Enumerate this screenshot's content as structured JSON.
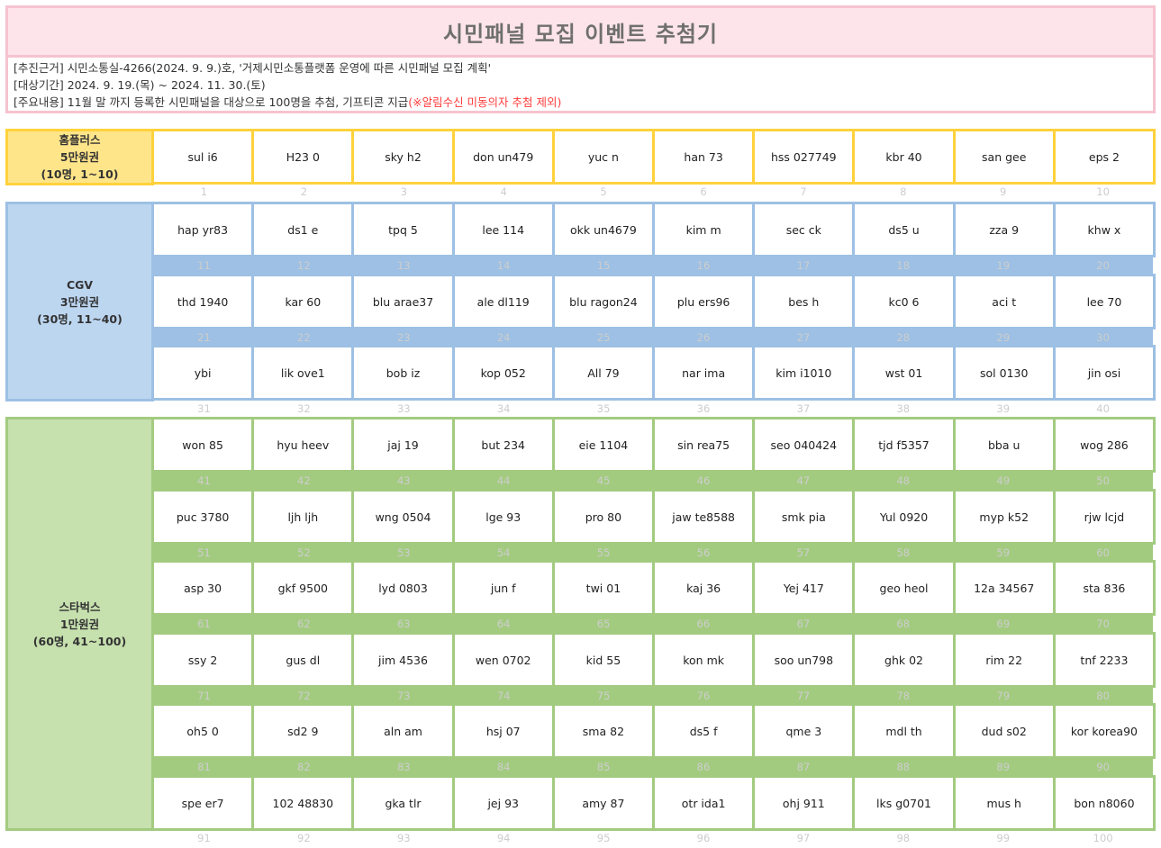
{
  "header": {
    "title": "시민패널 모집 이벤트 추첨기"
  },
  "info": {
    "line1": "[추진근거] 시민소통실-4266(2024. 9. 9.)호, '거제시민소통플랫폼 운영에 따른 시민패널 모집 계획'",
    "line2": "[대상기간] 2024. 9. 19.(목) ~ 2024. 11. 30.(토)",
    "line3_main": "[주요내용] 11월 말 까지 등록한 시민패널을 대상으로 100명을 추첨, 기프티콘 지급",
    "line3_note": "(※알림수신 미동의자 추첨 제외)"
  },
  "colors": {
    "pink_fill": "#fde4ea",
    "pink_border": "#f6c3cf",
    "yellow_fill": "#ffe58a",
    "yellow_border": "#ffd23c",
    "blue_fill": "#bcd6f0",
    "blue_border": "#9dc0e4",
    "green_fill": "#c6e0ae",
    "green_border": "#a3cb80",
    "note_red": "#ff3c3c"
  },
  "groups": [
    {
      "name": "홈플러스",
      "amount": "5만원권",
      "range": "(10명, 1~10)",
      "rows": [
        [
          "sul i6",
          "H23 0",
          "sky h2",
          "don un479",
          "yuc n",
          "han 73",
          "hss 027749",
          "kbr 40",
          "san gee",
          "eps 2"
        ]
      ],
      "numbers": [
        [
          "1",
          "2",
          "3",
          "4",
          "5",
          "6",
          "7",
          "8",
          "9",
          "10"
        ]
      ]
    },
    {
      "name": "CGV",
      "amount": "3만원권",
      "range": "(30명, 11~40)",
      "rows": [
        [
          "hap yr83",
          "ds1 e",
          "tpq 5",
          "lee 114",
          "okk un4679",
          "kim m",
          "sec ck",
          "ds5 u",
          "zza 9",
          "khw x"
        ],
        [
          "thd 1940",
          "kar 60",
          "blu arae37",
          "ale dl119",
          "blu ragon24",
          "plu ers96",
          "bes h",
          "kc0 6",
          "aci t",
          "lee 70"
        ],
        [
          "ybi",
          "lik ove1",
          "bob iz",
          "kop 052",
          "All 79",
          "nar ima",
          "kim i1010",
          "wst 01",
          "sol 0130",
          "jin osi"
        ]
      ],
      "numbers": [
        [
          "11",
          "12",
          "13",
          "14",
          "15",
          "16",
          "17",
          "18",
          "19",
          "20"
        ],
        [
          "21",
          "22",
          "23",
          "24",
          "25",
          "26",
          "27",
          "28",
          "29",
          "30"
        ],
        [
          "31",
          "32",
          "33",
          "34",
          "35",
          "36",
          "37",
          "38",
          "39",
          "40"
        ]
      ]
    },
    {
      "name": "스타벅스",
      "amount": "1만원권",
      "range": "(60명, 41~100)",
      "rows": [
        [
          "won 85",
          "hyu heev",
          "jaj 19",
          "but 234",
          "eie 1104",
          "sin rea75",
          "seo 040424",
          "tjd f5357",
          "bba u",
          "wog 286"
        ],
        [
          "puc 3780",
          "ljh ljh",
          "wng 0504",
          "lge 93",
          "pro 80",
          "jaw te8588",
          "smk pia",
          "Yul 0920",
          "myp k52",
          "rjw lcjd"
        ],
        [
          "asp 30",
          "gkf 9500",
          "lyd 0803",
          "jun f",
          "twi 01",
          "kaj 36",
          "Yej 417",
          "geo heol",
          "12a 34567",
          "sta 836"
        ],
        [
          "ssy 2",
          "gus dl",
          "jim 4536",
          "wen 0702",
          "kid 55",
          "kon mk",
          "soo un798",
          "ghk 02",
          "rim 22",
          "tnf 2233"
        ],
        [
          "oh5 0",
          "sd2 9",
          "aln am",
          "hsj 07",
          "sma 82",
          "ds5 f",
          "qme 3",
          "mdl th",
          "dud s02",
          "kor korea90"
        ],
        [
          "spe er7",
          "102 48830",
          "gka tlr",
          "jej 93",
          "amy 87",
          "otr ida1",
          "ohj 911",
          "lks g0701",
          "mus h",
          "bon n8060"
        ]
      ],
      "numbers": [
        [
          "41",
          "42",
          "43",
          "44",
          "45",
          "46",
          "47",
          "48",
          "49",
          "50"
        ],
        [
          "51",
          "52",
          "53",
          "54",
          "55",
          "56",
          "57",
          "58",
          "59",
          "60"
        ],
        [
          "61",
          "62",
          "63",
          "64",
          "65",
          "66",
          "67",
          "68",
          "69",
          "70"
        ],
        [
          "71",
          "72",
          "73",
          "74",
          "75",
          "76",
          "77",
          "78",
          "79",
          "80"
        ],
        [
          "81",
          "82",
          "83",
          "84",
          "85",
          "86",
          "87",
          "88",
          "89",
          "90"
        ],
        [
          "91",
          "92",
          "93",
          "94",
          "95",
          "96",
          "97",
          "98",
          "99",
          "100"
        ]
      ]
    }
  ]
}
